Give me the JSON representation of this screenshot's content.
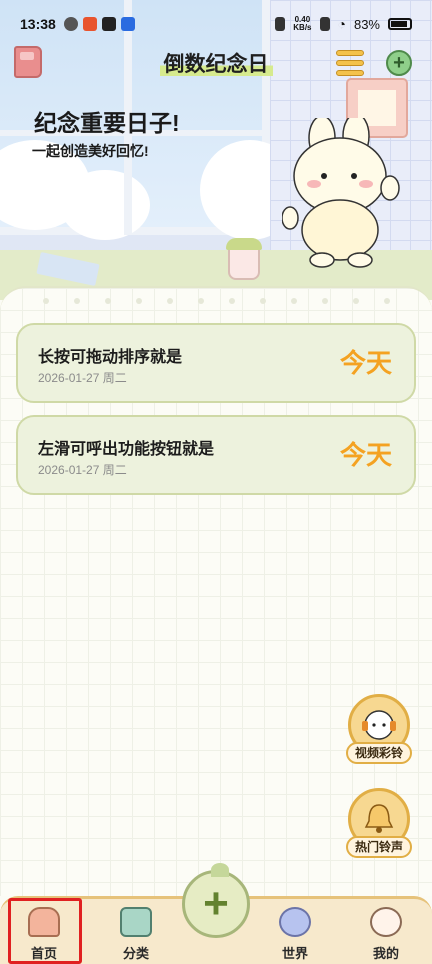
{
  "status_bar": {
    "time": "13:38",
    "net_speed_value": "0.40",
    "net_speed_unit": "KB/s",
    "battery": "83%"
  },
  "header": {
    "title": "倒数纪念日",
    "slogan": "纪念重要日子!",
    "subslogan": "一起创造美好回忆!"
  },
  "events": [
    {
      "title": "长按可拖动排序就是",
      "date": "2026-01-27 周二",
      "countdown": "今天"
    },
    {
      "title": "左滑可呼出功能按钮就是",
      "date": "2026-01-27 周二",
      "countdown": "今天"
    }
  ],
  "floating_buttons": {
    "video_ringtone": "视频彩铃",
    "hot_ringtone": "热门铃声"
  },
  "bottom_nav": {
    "home": "首页",
    "category": "分类",
    "add": "+",
    "world": "世界",
    "mine": "我的"
  },
  "colors": {
    "accent_orange": "#f4a221",
    "card_bg": "#edf2dd",
    "nav_bg": "#f7e9cc",
    "selected_outline": "#e02020"
  }
}
